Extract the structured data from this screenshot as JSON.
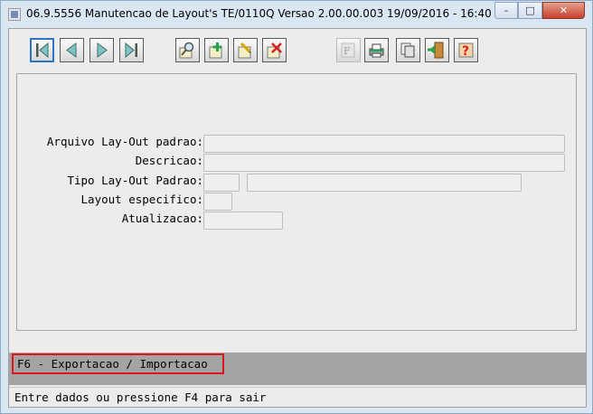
{
  "window": {
    "title": "06.9.5556 Manutencao  de Layout's TE/0110Q Versao 2.00.00.003 19/09/2016 - 16:40",
    "controls": {
      "minimize": "–",
      "maximize": "□",
      "close": "✕"
    }
  },
  "toolbar": {
    "buttons": [
      {
        "name": "first-record",
        "icon": "first-record-icon"
      },
      {
        "name": "previous-record",
        "icon": "previous-record-icon"
      },
      {
        "name": "next-record",
        "icon": "next-record-icon"
      },
      {
        "name": "last-record",
        "icon": "last-record-icon"
      },
      {
        "name": "search",
        "icon": "magnifier-icon"
      },
      {
        "name": "add",
        "icon": "add-record-icon"
      },
      {
        "name": "edit",
        "icon": "edit-record-icon"
      },
      {
        "name": "delete",
        "icon": "delete-record-icon"
      },
      {
        "name": "filter",
        "icon": "filter-icon"
      },
      {
        "name": "print",
        "icon": "print-icon"
      },
      {
        "name": "copy",
        "icon": "copy-icon"
      },
      {
        "name": "exit",
        "icon": "exit-door-icon"
      },
      {
        "name": "help",
        "icon": "help-icon"
      }
    ]
  },
  "form": {
    "arquivo_label": "Arquivo Lay-Out padrao:",
    "arquivo_value": "",
    "descricao_label": "Descricao:",
    "descricao_value": "",
    "tipo_label": "Tipo Lay-Out Padrao:",
    "tipo_code_value": "",
    "tipo_desc_value": "",
    "layout_especifico_label": "Layout especifico:",
    "layout_especifico_value": "",
    "atualizacao_label": "Atualizacao:",
    "atualizacao_value": ""
  },
  "fkeys": {
    "f6": "F6 - Exportacao / Importacao"
  },
  "status": {
    "message": "Entre dados ou pressione F4 para sair"
  },
  "colors": {
    "fkey_bar": "#a4a4a4",
    "highlight_border": "#e0141c",
    "selected_button_border": "#2f73c7"
  }
}
